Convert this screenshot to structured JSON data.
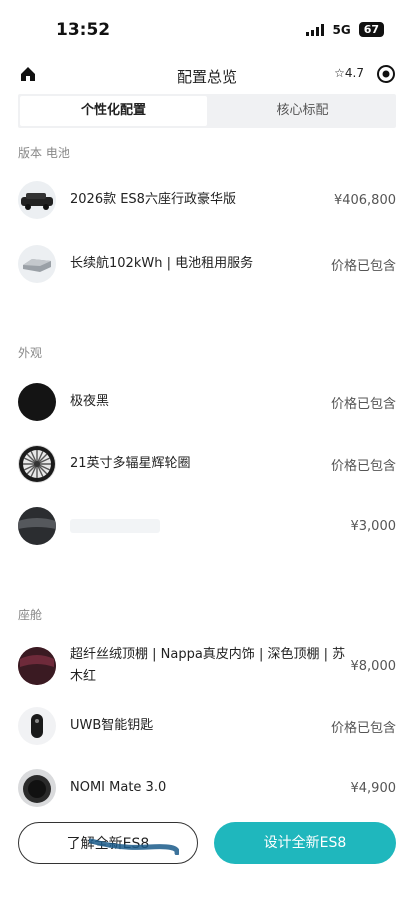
{
  "status_bar": {
    "time": "13:52",
    "network": "5G",
    "battery": "67"
  },
  "nav": {
    "title": "配置总览",
    "rating": "4.7"
  },
  "tabs": [
    {
      "label": "个性化配置",
      "active": true
    },
    {
      "label": "核心标配",
      "active": false
    }
  ],
  "sections": {
    "version": {
      "title": "版本 电池",
      "items": [
        {
          "label": "2026款 ES8六座行政豪华版",
          "price": "¥406,800"
        },
        {
          "label": "长续航102kWh | 电池租用服务",
          "price": "价格已包含"
        }
      ]
    },
    "exterior": {
      "title": "外观",
      "items": [
        {
          "label": "极夜黑",
          "price": "价格已包含"
        },
        {
          "label": "21英寸多辐星辉轮圈",
          "price": "价格已包含"
        },
        {
          "label": "",
          "price": "¥3,000"
        }
      ]
    },
    "cabin": {
      "title": "座舱",
      "items": [
        {
          "label": "超纤丝绒顶棚 | Nappa真皮内饰 | 深色顶棚 | 苏木红",
          "price": "¥8,000"
        },
        {
          "label": "UWB智能钥匙",
          "price": "价格已包含"
        },
        {
          "label": "NOMI Mate 3.0",
          "price": "¥4,900"
        }
      ]
    }
  },
  "footer": {
    "learn_label": "了解全新ES8",
    "design_label": "设计全新ES8"
  },
  "colors": {
    "accent": "#1fb7bd",
    "paint_black": "#141414",
    "interior_red": "#5a2230"
  }
}
